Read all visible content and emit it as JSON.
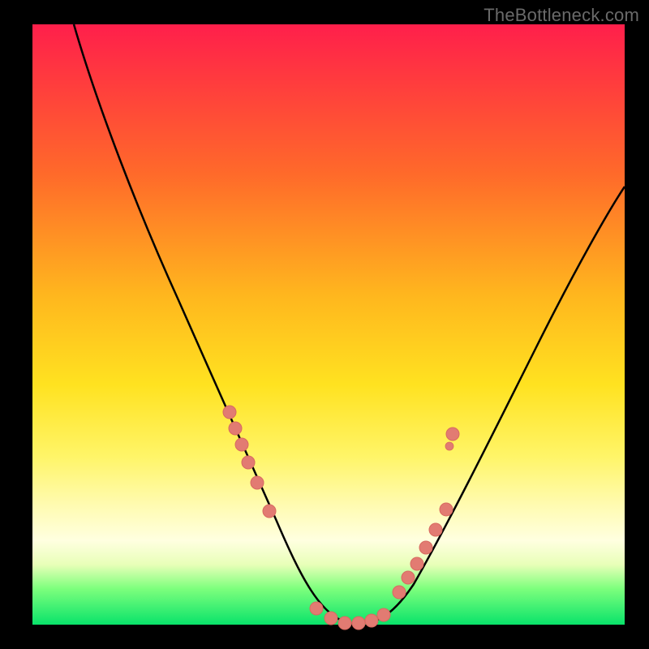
{
  "watermark": "TheBottleneck.com",
  "colors": {
    "background": "#000000",
    "gradient_top": "#ff1f4b",
    "gradient_bottom": "#09e36a",
    "curve": "#000000",
    "dots": "#e27b72"
  },
  "chart_data": {
    "type": "line",
    "title": "",
    "xlabel": "",
    "ylabel": "",
    "xlim": [
      0,
      100
    ],
    "ylim": [
      0,
      100
    ],
    "grid": false,
    "series": [
      {
        "name": "bottleneck-curve",
        "x": [
          7,
          10,
          14,
          18,
          22,
          26,
          30,
          33,
          36,
          39,
          42,
          44,
          46,
          48,
          50,
          52,
          54,
          56,
          58,
          60,
          63,
          67,
          72,
          78,
          85,
          92,
          100
        ],
        "y": [
          100,
          90,
          80,
          70,
          60,
          50,
          42,
          36,
          30,
          24,
          18,
          13,
          8,
          4,
          1,
          0,
          0,
          0,
          1,
          3,
          7,
          12,
          20,
          30,
          42,
          55,
          68
        ]
      }
    ],
    "markers": [
      {
        "name": "left-cluster",
        "points": [
          {
            "x": 33,
            "y": 35
          },
          {
            "x": 34,
            "y": 32
          },
          {
            "x": 35.5,
            "y": 29
          },
          {
            "x": 36.5,
            "y": 26
          },
          {
            "x": 38,
            "y": 23
          },
          {
            "x": 40,
            "y": 18
          }
        ]
      },
      {
        "name": "valley-cluster",
        "points": [
          {
            "x": 48,
            "y": 2
          },
          {
            "x": 50,
            "y": 1
          },
          {
            "x": 52,
            "y": 0
          },
          {
            "x": 54,
            "y": 0
          },
          {
            "x": 56,
            "y": 0
          },
          {
            "x": 58,
            "y": 1
          }
        ]
      },
      {
        "name": "right-cluster",
        "points": [
          {
            "x": 62,
            "y": 6
          },
          {
            "x": 63.5,
            "y": 8
          },
          {
            "x": 65,
            "y": 10
          },
          {
            "x": 66.5,
            "y": 12.5
          },
          {
            "x": 68,
            "y": 15
          },
          {
            "x": 70,
            "y": 19
          },
          {
            "x": 70.5,
            "y": 30
          },
          {
            "x": 71,
            "y": 32
          }
        ]
      }
    ]
  }
}
